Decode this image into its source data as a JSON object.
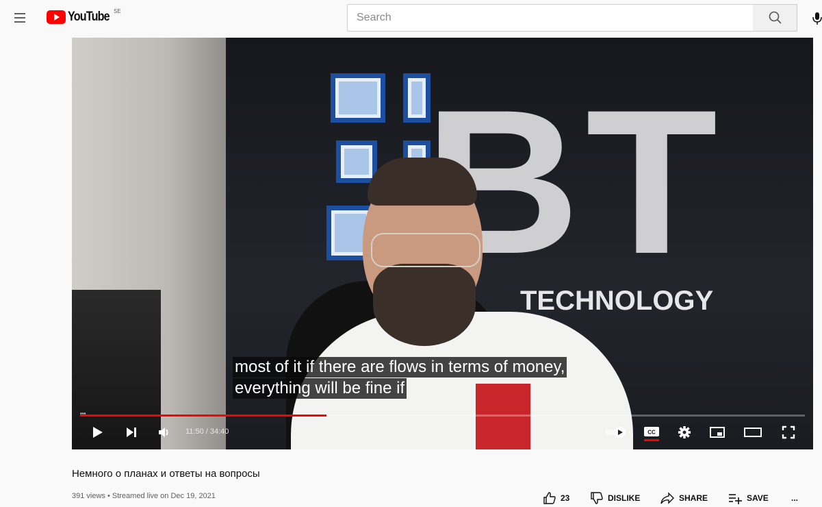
{
  "header": {
    "logo_text": "YouTube",
    "logo_country": "SE",
    "search_placeholder": "Search",
    "icons": [
      "hamburger-menu-icon",
      "search-icon",
      "microphone-icon"
    ]
  },
  "video": {
    "captions": [
      "most of it if there are flows in terms of money,",
      "everything will be fine if"
    ],
    "overlay_text": {
      "logo": "BT",
      "tagline": "TECHNOLOGY"
    },
    "progress_fraction": 0.34,
    "time_display": "11:50 / 34:40",
    "accent_color": "#ff0000",
    "controls": [
      "play-icon",
      "next-icon",
      "volume-icon",
      "autoplay-toggle",
      "subtitles-icon",
      "settings-icon",
      "miniplayer-icon",
      "theater-icon",
      "fullscreen-icon"
    ]
  },
  "info": {
    "title": "Немного о планах и ответы на вопросы",
    "meta": "391 views • Streamed live on Dec 19, 2021",
    "like_count": "23",
    "dislike_label": "DISLIKE",
    "share_label": "SHARE",
    "save_label": "SAVE",
    "more_label": "..."
  }
}
